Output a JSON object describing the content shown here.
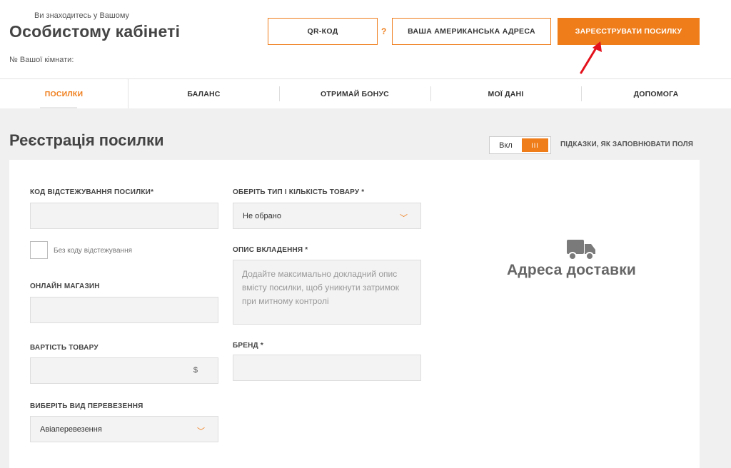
{
  "header": {
    "subtitle": "Ви знаходитесь у Вашому",
    "title": "Особистому кабінеті",
    "room_label": "№ Вашої кімнати:",
    "qr_button": "QR-КОД",
    "help_mark": "?",
    "address_button": "ВАША АМЕРИКАНСЬКА АДРЕСА",
    "register_button": "ЗАРЕЄСТРУВАТИ ПОСИЛКУ"
  },
  "nav": {
    "items": [
      {
        "label": "ПОСИЛКИ"
      },
      {
        "label": "БАЛАНС"
      },
      {
        "label": "ОТРИМАЙ БОНУС"
      },
      {
        "label": "МОЇ ДАНІ"
      },
      {
        "label": "ДОПОМОГА"
      }
    ]
  },
  "page": {
    "title": "Реєстрація посилки",
    "toggle_label": "Вкл",
    "toggle_knob": "III",
    "hints_text": "ПІДКАЗКИ, ЯК ЗАПОВНЮВАТИ ПОЛЯ"
  },
  "form": {
    "tracking_label": "КОД ВІДСТЕЖУВАННЯ ПОСИЛКИ*",
    "no_tracking_label": "Без коду відстежування",
    "shop_label": "ОНЛАЙН МАГАЗИН",
    "price_label": "ВАРТІСТЬ ТОВАРУ",
    "price_currency": "$",
    "transport_label": "ВИБЕРІТЬ ВИД ПЕРЕВЕЗЕННЯ",
    "transport_value": "Авіаперевезення",
    "type_label": "ОБЕРІТЬ ТИП І КІЛЬКІСТЬ ТОВАРУ *",
    "type_value": "Не обрано",
    "description_label": "ОПИС ВКЛАДЕННЯ *",
    "description_placeholder": "Додайте максимально докладний опис вмісту посилки, щоб уникнути затримок при митному контролі",
    "brand_label": "БРЕНД *"
  },
  "delivery": {
    "title": "Адреса доставки"
  },
  "colors": {
    "accent": "#ef7d1a",
    "background": "#f0f0f0"
  }
}
